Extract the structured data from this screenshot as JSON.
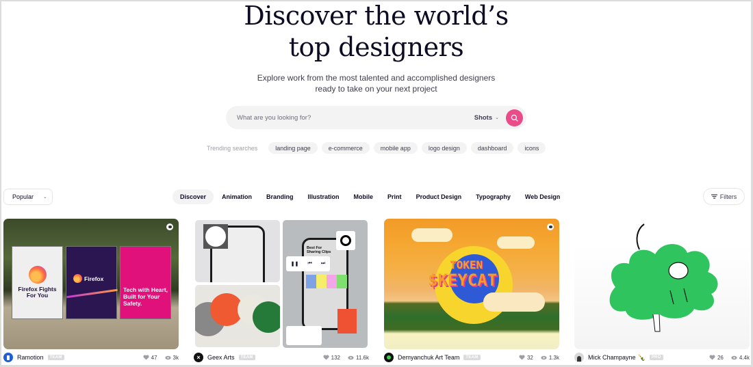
{
  "hero": {
    "title_line1": "Discover the world’s",
    "title_line2": "top designers",
    "subtitle_line1": "Explore work from the most talented and accomplished designers",
    "subtitle_line2": "ready to take on your next project"
  },
  "search": {
    "placeholder": "What are you looking for?",
    "scope": "Shots",
    "button_color": "#ea4c89"
  },
  "trending": {
    "label": "Trending searches",
    "items": [
      "landing page",
      "e-commerce",
      "mobile app",
      "logo design",
      "dashboard",
      "icons"
    ]
  },
  "filters_bar": {
    "sort_selected": "Popular",
    "categories": [
      "Discover",
      "Animation",
      "Branding",
      "Illustration",
      "Mobile",
      "Print",
      "Product Design",
      "Typography",
      "Web Design"
    ],
    "active_category": "Discover",
    "filters_label": "Filters"
  },
  "shots": [
    {
      "author": "Ramotion",
      "badge": "TEAM",
      "likes": "47",
      "views": "3k",
      "image_alt": "Firefox billboard posters",
      "poster_texts": [
        "Firefox Fights For You",
        "Firefox",
        "Tech with Heart, Built for Your Safety."
      ]
    },
    {
      "author": "Geex Arts",
      "badge": "TEAM",
      "likes": "132",
      "views": "11.6k",
      "image_alt": "Mobile audio app mockups",
      "phone_text": "Best For Sharing Clips"
    },
    {
      "author": "Demyanchuk Art Team",
      "badge": "TEAM",
      "likes": "32",
      "views": "1.3k",
      "image_alt": "Pixel art sunset",
      "art_text_line1": "TOKEN",
      "art_text_line2": "$KEYCAT"
    },
    {
      "author": "Mick Champayne",
      "emoji": "🍾",
      "badge": "PRO",
      "likes": "26",
      "views": "4.4k",
      "image_alt": "Dog in a green bush illustration"
    }
  ]
}
